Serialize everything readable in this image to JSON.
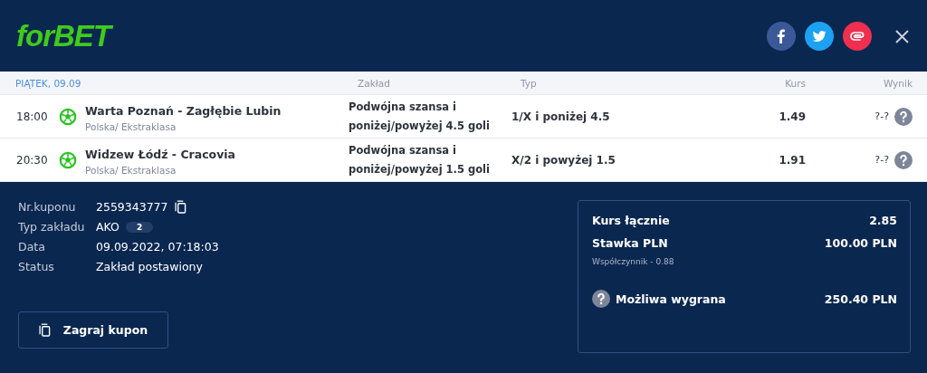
{
  "logo": "forBET",
  "share": [
    {
      "kind": "facebook"
    },
    {
      "kind": "twitter"
    },
    {
      "kind": "link"
    }
  ],
  "table": {
    "date": "PIĄTEK, 09.09",
    "columns": [
      "Zakład",
      "Typ",
      "Kurs",
      "Wynik"
    ],
    "rows": [
      {
        "time": "18:00",
        "match": "Warta Poznań - Zagłębie Lubin",
        "league": "Polska/ Ekstraklasa",
        "bet": "Podwójna szansa i poniżej/powyżej 4.5 goli",
        "type": "1/X i poniżej 4.5",
        "odds": "1.49",
        "result": "?-?"
      },
      {
        "time": "20:30",
        "match": "Widzew Łódź - Cracovia",
        "league": "Polska/ Ekstraklasa",
        "bet": "Podwójna szansa i poniżej/powyżej 1.5 goli",
        "type": "X/2 i powyżej 1.5",
        "odds": "1.91",
        "result": "?-?"
      }
    ]
  },
  "details": [
    {
      "label": "Nr.kuponu",
      "value": "2559343777",
      "kind": "copy"
    },
    {
      "label": "Typ zakładu",
      "value": "AKO",
      "badge": "2",
      "kind": "badge"
    },
    {
      "label": "Data",
      "value": "09.09.2022, 07:18:03",
      "kind": "plain"
    },
    {
      "label": "Status",
      "value": "Zakład postawiony",
      "kind": "plain"
    }
  ],
  "replay_button": "Zagraj kupon",
  "summary": {
    "total_odds_label": "Kurs łącznie",
    "total_odds": "2.85",
    "stake_label": "Stawka PLN",
    "stake": "100.00 PLN",
    "coefficient": "Współczynnik - 0.88",
    "win_label": "Możliwa wygrana",
    "win": "250.40 PLN"
  }
}
